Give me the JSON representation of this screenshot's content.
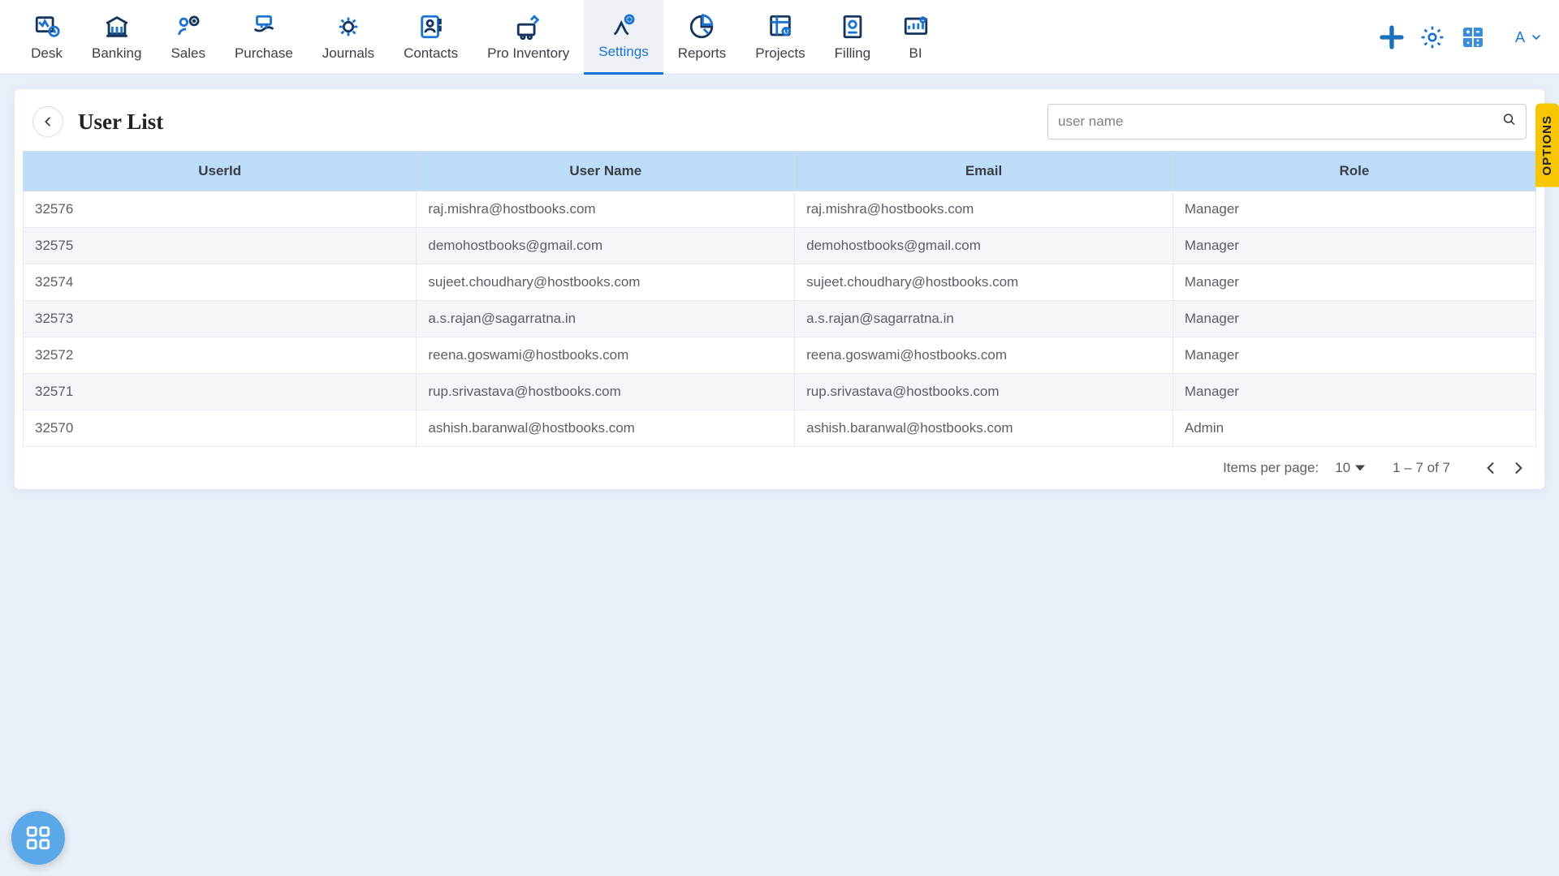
{
  "nav": {
    "items": [
      {
        "label": "Desk"
      },
      {
        "label": "Banking"
      },
      {
        "label": "Sales"
      },
      {
        "label": "Purchase"
      },
      {
        "label": "Journals"
      },
      {
        "label": "Contacts"
      },
      {
        "label": "Pro Inventory"
      },
      {
        "label": "Settings"
      },
      {
        "label": "Reports"
      },
      {
        "label": "Projects"
      },
      {
        "label": "Filling"
      },
      {
        "label": "BI"
      }
    ],
    "active_index": 7
  },
  "profile_letter": "A",
  "page": {
    "title": "User List"
  },
  "search": {
    "placeholder": "user name"
  },
  "table": {
    "headers": [
      "UserId",
      "User Name",
      "Email",
      "Role"
    ],
    "rows": [
      {
        "userid": "32576",
        "username": "raj.mishra@hostbooks.com",
        "email": "raj.mishra@hostbooks.com",
        "role": "Manager"
      },
      {
        "userid": "32575",
        "username": "demohostbooks@gmail.com",
        "email": "demohostbooks@gmail.com",
        "role": "Manager"
      },
      {
        "userid": "32574",
        "username": "sujeet.choudhary@hostbooks.com",
        "email": "sujeet.choudhary@hostbooks.com",
        "role": "Manager"
      },
      {
        "userid": "32573",
        "username": "a.s.rajan@sagarratna.in",
        "email": "a.s.rajan@sagarratna.in",
        "role": "Manager"
      },
      {
        "userid": "32572",
        "username": "reena.goswami@hostbooks.com",
        "email": "reena.goswami@hostbooks.com",
        "role": "Manager"
      },
      {
        "userid": "32571",
        "username": "rup.srivastava@hostbooks.com",
        "email": "rup.srivastava@hostbooks.com",
        "role": "Manager"
      },
      {
        "userid": "32570",
        "username": "ashish.baranwal@hostbooks.com",
        "email": "ashish.baranwal@hostbooks.com",
        "role": "Admin"
      }
    ]
  },
  "pager": {
    "items_per_page_label": "Items per page:",
    "items_per_page_value": "10",
    "range": "1 – 7 of 7"
  },
  "options_tab": "OPTIONS"
}
